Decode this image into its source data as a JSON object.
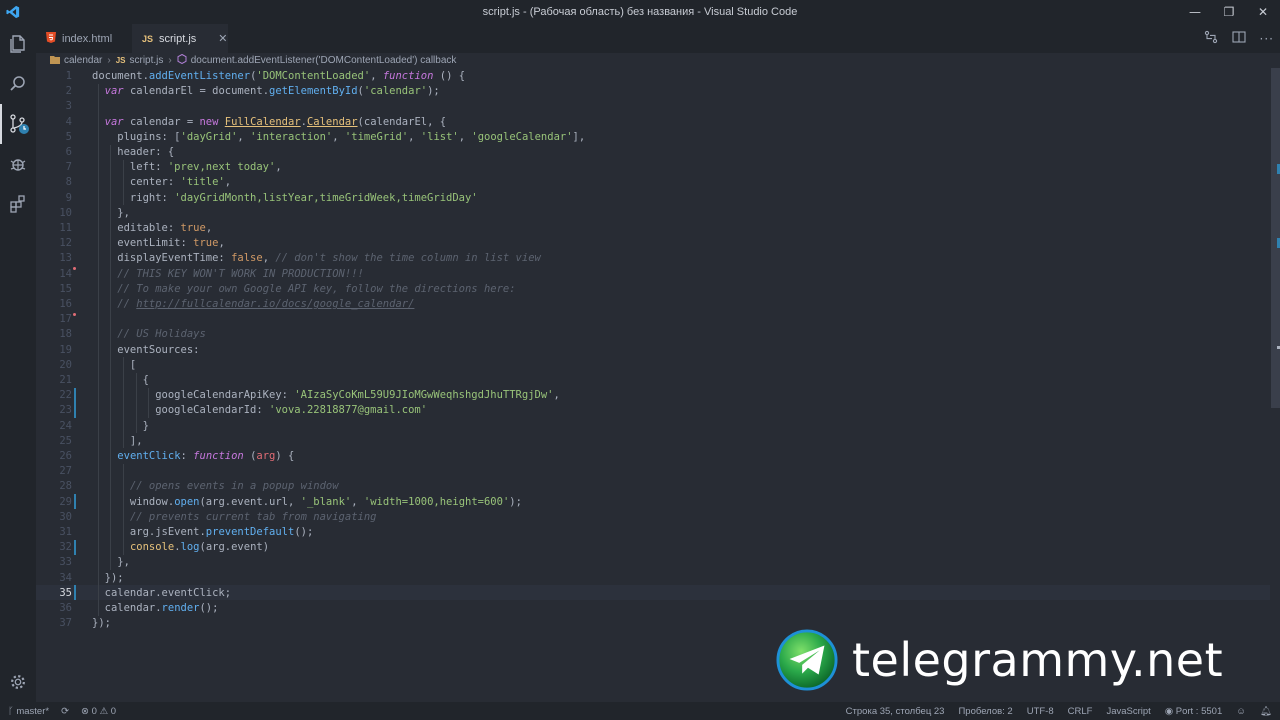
{
  "window": {
    "title": "script.js - (Рабочая область) без названия - Visual Studio Code"
  },
  "tabs": [
    {
      "label": "index.html",
      "icon": "html5-icon"
    },
    {
      "label": "script.js",
      "icon": "js-icon",
      "close": "✕"
    }
  ],
  "breadcrumb": {
    "folder": "calendar",
    "file": "script.js",
    "symbol": "document.addEventListener('DOMContentLoaded') callback"
  },
  "editor": {
    "current_line": 35,
    "line_numbers": [
      "1",
      "2",
      "3",
      "4",
      "5",
      "6",
      "7",
      "8",
      "9",
      "10",
      "11",
      "12",
      "13",
      "14",
      "15",
      "16",
      "17",
      "18",
      "19",
      "20",
      "21",
      "22",
      "23",
      "24",
      "25",
      "26",
      "27",
      "28",
      "29",
      "30",
      "31",
      "32",
      "33",
      "34",
      "35",
      "36",
      "37"
    ],
    "lines": [
      [
        [
          "p",
          "document."
        ],
        [
          "f",
          "addEventListener"
        ],
        [
          "p",
          "("
        ],
        [
          "s",
          "'DOMContentLoaded'"
        ],
        [
          "p",
          ", "
        ],
        [
          "ki",
          "function"
        ],
        [
          "p",
          " () {"
        ]
      ],
      [
        [
          "p",
          "  "
        ],
        [
          "ki",
          "var"
        ],
        [
          "p",
          " calendarEl = document."
        ],
        [
          "f",
          "getElementById"
        ],
        [
          "p",
          "("
        ],
        [
          "s",
          "'calendar'"
        ],
        [
          "p",
          ");"
        ]
      ],
      [],
      [
        [
          "p",
          "  "
        ],
        [
          "ki",
          "var"
        ],
        [
          "p",
          " calendar = "
        ],
        [
          "k",
          "new"
        ],
        [
          "p",
          " "
        ],
        [
          "cl u",
          "FullCalendar"
        ],
        [
          "p",
          "."
        ],
        [
          "cl u",
          "Calendar"
        ],
        [
          "p",
          "(calendarEl, {"
        ]
      ],
      [
        [
          "p",
          "    plugins: ["
        ],
        [
          "s",
          "'dayGrid'"
        ],
        [
          "p",
          ", "
        ],
        [
          "s",
          "'interaction'"
        ],
        [
          "p",
          ", "
        ],
        [
          "s",
          "'timeGrid'"
        ],
        [
          "p",
          ", "
        ],
        [
          "s",
          "'list'"
        ],
        [
          "p",
          ", "
        ],
        [
          "s",
          "'googleCalendar'"
        ],
        [
          "p",
          "],"
        ]
      ],
      [
        [
          "p",
          "    header: {"
        ]
      ],
      [
        [
          "p",
          "      left: "
        ],
        [
          "s",
          "'prev,next today'"
        ],
        [
          "p",
          ","
        ]
      ],
      [
        [
          "p",
          "      center: "
        ],
        [
          "s",
          "'title'"
        ],
        [
          "p",
          ","
        ]
      ],
      [
        [
          "p",
          "      right: "
        ],
        [
          "s",
          "'dayGridMonth,listYear,timeGridWeek,timeGridDay'"
        ]
      ],
      [
        [
          "p",
          "    },"
        ]
      ],
      [
        [
          "p",
          "    editable: "
        ],
        [
          "b",
          "true"
        ],
        [
          "p",
          ","
        ]
      ],
      [
        [
          "p",
          "    eventLimit: "
        ],
        [
          "b",
          "true"
        ],
        [
          "p",
          ","
        ]
      ],
      [
        [
          "p",
          "    displayEventTime: "
        ],
        [
          "b",
          "false"
        ],
        [
          "p",
          ", "
        ],
        [
          "c",
          "// don't show the time column in list view"
        ]
      ],
      [
        [
          "p",
          "    "
        ],
        [
          "c",
          "// THIS KEY WON'T WORK IN PRODUCTION!!!"
        ]
      ],
      [
        [
          "p",
          "    "
        ],
        [
          "c",
          "// To make your own Google API key, follow the directions here:"
        ]
      ],
      [
        [
          "p",
          "    "
        ],
        [
          "c",
          "// "
        ],
        [
          "c u",
          "http://fullcalendar.io/docs/google_calendar/"
        ]
      ],
      [],
      [
        [
          "p",
          "    "
        ],
        [
          "c",
          "// US Holidays"
        ]
      ],
      [
        [
          "p",
          "    eventSources:"
        ]
      ],
      [
        [
          "p",
          "      ["
        ]
      ],
      [
        [
          "p",
          "        {"
        ]
      ],
      [
        [
          "p",
          "          googleCalendarApiKey: "
        ],
        [
          "s",
          "'AIzaSyCoKmL59U9JIoMGwWeqhshgdJhuTTRgjDw'"
        ],
        [
          "p",
          ","
        ]
      ],
      [
        [
          "p",
          "          googleCalendarId: "
        ],
        [
          "s",
          "'vova.22818877@gmail.com'"
        ]
      ],
      [
        [
          "p",
          "        }"
        ]
      ],
      [
        [
          "p",
          "      ],"
        ]
      ],
      [
        [
          "p",
          "    "
        ],
        [
          "f",
          "eventClick"
        ],
        [
          "p",
          ": "
        ],
        [
          "ki",
          "function"
        ],
        [
          "p",
          " ("
        ],
        [
          "v",
          "arg"
        ],
        [
          "p",
          ") {"
        ]
      ],
      [],
      [
        [
          "p",
          "      "
        ],
        [
          "c",
          "// opens events in a popup window"
        ]
      ],
      [
        [
          "p",
          "      window."
        ],
        [
          "f",
          "open"
        ],
        [
          "p",
          "(arg.event.url, "
        ],
        [
          "s",
          "'_blank'"
        ],
        [
          "p",
          ", "
        ],
        [
          "s",
          "'width=1000,height=600'"
        ],
        [
          "p",
          ");"
        ]
      ],
      [
        [
          "p",
          "      "
        ],
        [
          "c",
          "// prevents current tab from navigating"
        ]
      ],
      [
        [
          "p",
          "      arg.jsEvent."
        ],
        [
          "f",
          "preventDefault"
        ],
        [
          "p",
          "();"
        ]
      ],
      [
        [
          "p",
          "      "
        ],
        [
          "cl",
          "console"
        ],
        [
          "p",
          "."
        ],
        [
          "f",
          "log"
        ],
        [
          "p",
          "(arg.event)"
        ]
      ],
      [
        [
          "p",
          "    },"
        ]
      ],
      [
        [
          "p",
          "  });"
        ]
      ],
      [
        [
          "p",
          "  calendar.eventClick;"
        ]
      ],
      [
        [
          "p",
          "  calendar."
        ],
        [
          "f",
          "render"
        ],
        [
          "p",
          "();"
        ]
      ],
      [
        [
          "p",
          "});"
        ]
      ]
    ]
  },
  "watermark": {
    "text": "telegrammy.net"
  },
  "statusbar": {
    "branch": "master*",
    "errors": "0",
    "warnings": "0",
    "position": "Строка 35, столбец 23",
    "spaces": "Пробелов: 2",
    "encoding": "UTF-8",
    "eol": "CRLF",
    "language": "JavaScript",
    "port": "Port : 5501"
  },
  "colors": {
    "keyword": "#c678dd",
    "function": "#61afef",
    "string": "#98c379",
    "comment": "#5c6370",
    "boolean": "#d19a66",
    "class": "#e5c07b",
    "modified_gutter": "#2f81b0"
  }
}
